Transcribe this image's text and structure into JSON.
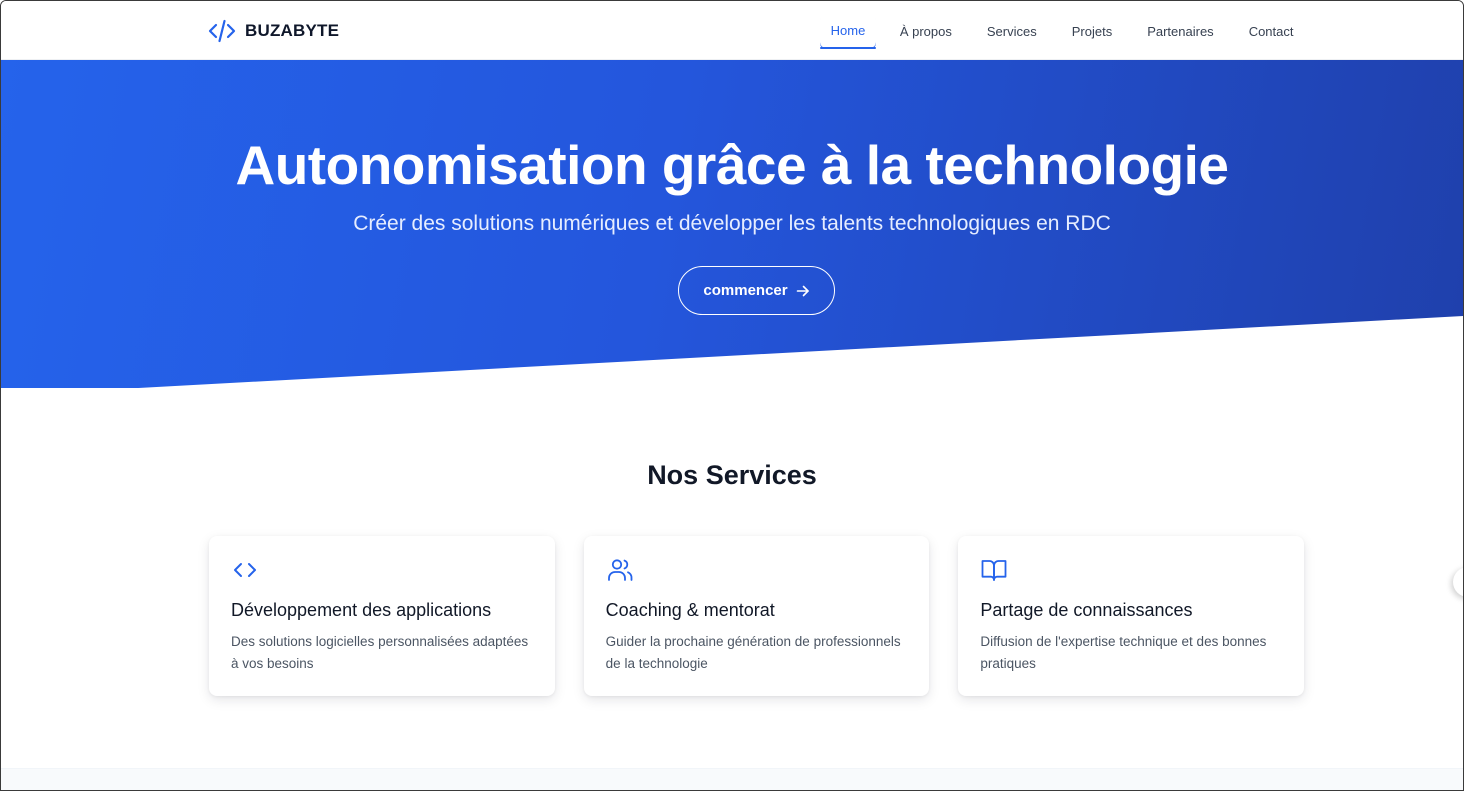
{
  "brand": {
    "name": "BUZABYTE",
    "icon": "code-icon"
  },
  "nav": {
    "items": [
      {
        "label": "Home",
        "active": true
      },
      {
        "label": "À propos",
        "active": false
      },
      {
        "label": "Services",
        "active": false
      },
      {
        "label": "Projets",
        "active": false
      },
      {
        "label": "Partenaires",
        "active": false
      },
      {
        "label": "Contact",
        "active": false
      }
    ]
  },
  "hero": {
    "title": "Autonomisation grâce à la technologie",
    "subtitle": "Créer des solutions numériques et développer les talents technologiques en RDC",
    "cta_label": "commencer",
    "cta_icon": "arrow-right-icon"
  },
  "services": {
    "title": "Nos Services",
    "cards": [
      {
        "icon": "code-icon",
        "title": "Développement des applications",
        "desc": "Des solutions logicielles personnalisées adaptées à vos besoins"
      },
      {
        "icon": "users-icon",
        "title": "Coaching & mentorat",
        "desc": "Guider la prochaine génération de professionnels de la technologie"
      },
      {
        "icon": "book-open-icon",
        "title": "Partage de connaissances",
        "desc": "Diffusion de l'expertise technique et des bonnes pratiques"
      }
    ]
  },
  "colors": {
    "accent": "#2563eb",
    "hero_start": "#2563eb",
    "hero_end": "#1f40ac",
    "text_dark": "#111827",
    "text_muted": "#4b5563"
  }
}
